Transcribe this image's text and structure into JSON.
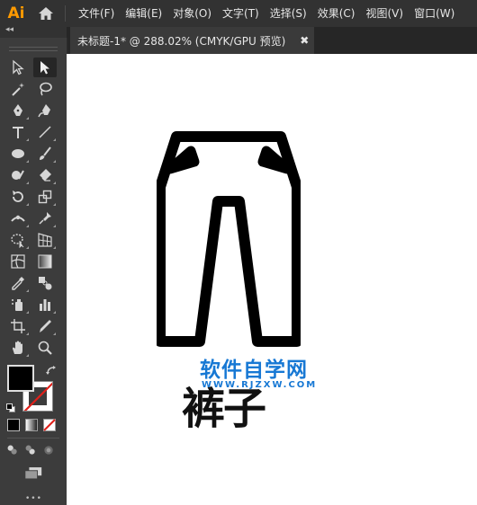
{
  "app": {
    "logo": "Ai"
  },
  "menu": [
    "文件(F)",
    "编辑(E)",
    "对象(O)",
    "文字(T)",
    "选择(S)",
    "效果(C)",
    "视图(V)",
    "窗口(W)"
  ],
  "toolbar": {
    "collapse": "◂◂",
    "more": "•••"
  },
  "document_tab": {
    "title": "未标题-1* @ 288.02% (CMYK/GPU 预览)",
    "close": "✖"
  },
  "artwork": {
    "caption": "裤子"
  },
  "watermark": {
    "main": "软件自学网",
    "sub": "WWW.RJZXW.COM"
  },
  "colors": {
    "fill": "#000000",
    "stroke": "none",
    "accent": "#FF9A00",
    "watermark": "#1778D4"
  }
}
